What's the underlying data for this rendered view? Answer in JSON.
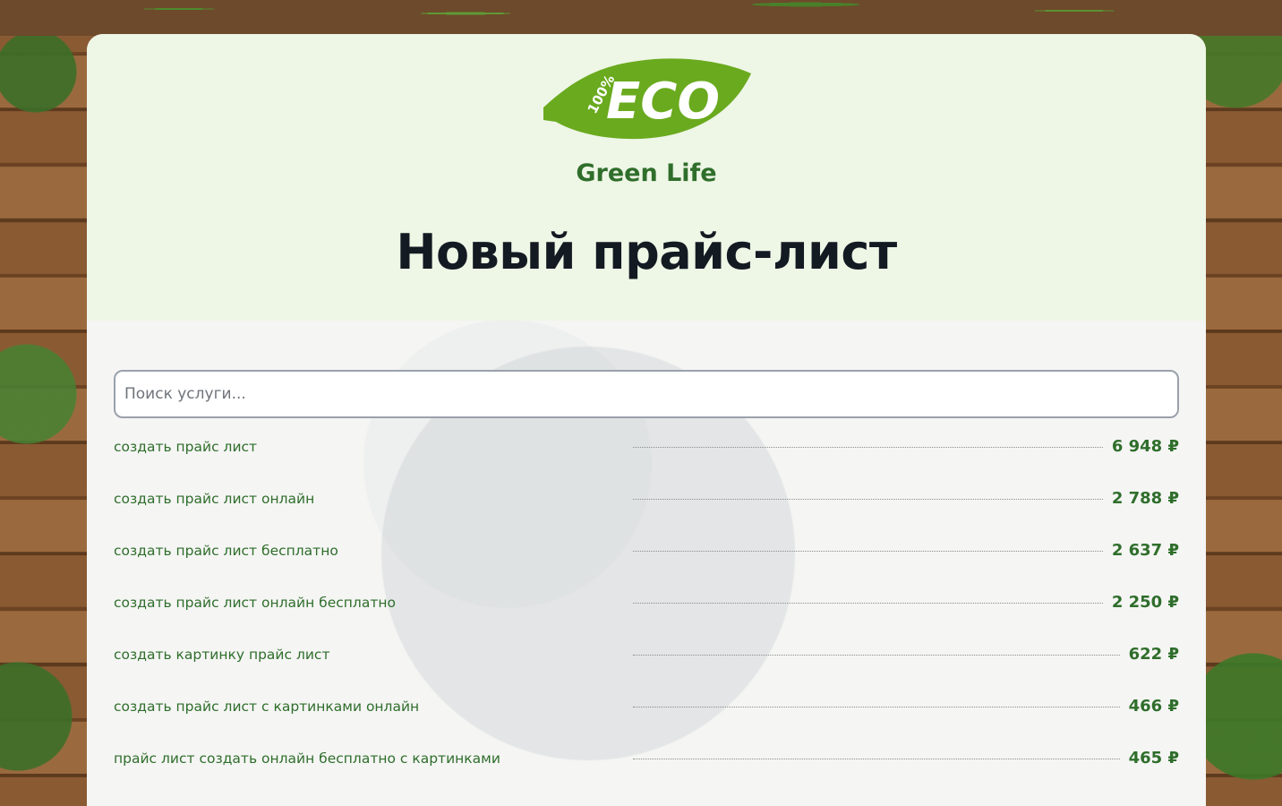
{
  "brand": {
    "logo_badge": "100%",
    "logo_word": "ECO",
    "name": "Green Life"
  },
  "page": {
    "title": "Новый прайс-лист"
  },
  "search": {
    "placeholder": "Поиск услуги..."
  },
  "services": [
    {
      "name": "создать прайс лист",
      "price": "6 948 ₽"
    },
    {
      "name": "создать прайс лист онлайн",
      "price": "2 788 ₽"
    },
    {
      "name": "создать прайс лист бесплатно",
      "price": "2 637 ₽"
    },
    {
      "name": "создать прайс лист онлайн бесплатно",
      "price": "2 250 ₽"
    },
    {
      "name": "создать картинку прайс лист",
      "price": "622 ₽"
    },
    {
      "name": "создать прайс лист с картинками онлайн",
      "price": "466 ₽"
    },
    {
      "name": "прайс лист создать онлайн бесплатно с картинками",
      "price": "465 ₽"
    }
  ],
  "colors": {
    "accent": "#2f6e2b",
    "leaf": "#6aaa1e",
    "header_bg": "#eef6e6",
    "title": "#141a22"
  }
}
